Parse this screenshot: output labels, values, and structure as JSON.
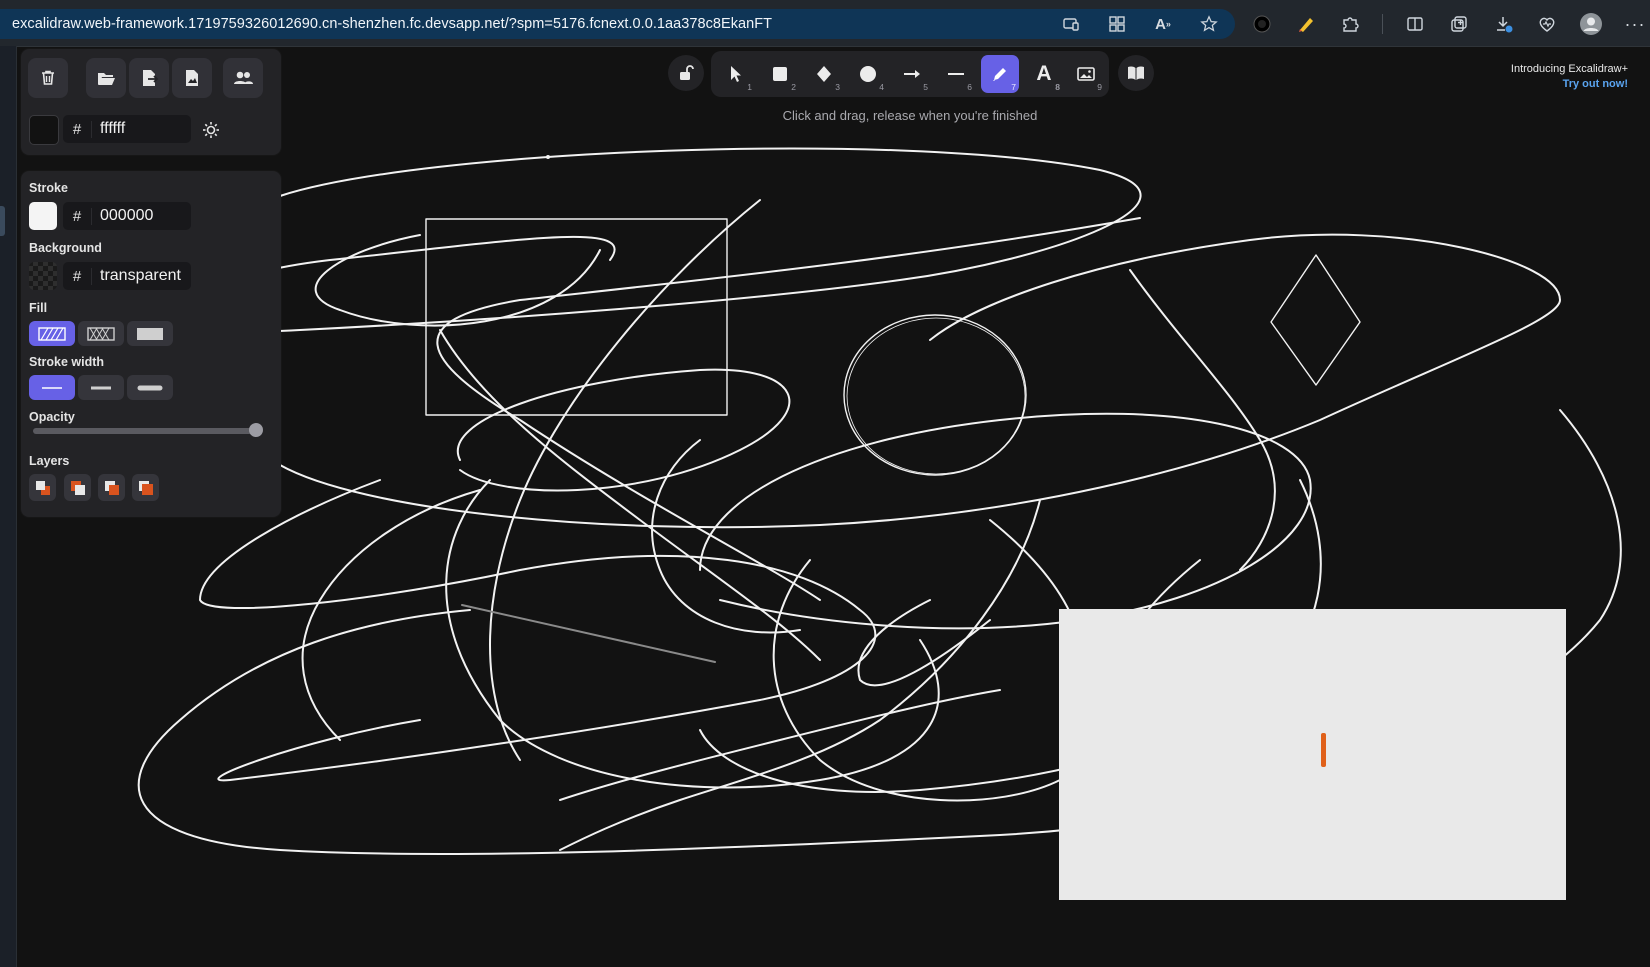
{
  "browser": {
    "url": "excalidraw.web-framework.1719759326012690.cn-shenzhen.fc.devsapp.net/?spm=5176.fcnext.0.0.1aa378c8EkanFT"
  },
  "canvas_panel": {
    "canvas_bg_hash": "#",
    "canvas_bg_value": "ffffff"
  },
  "properties": {
    "stroke_label": "Stroke",
    "stroke_hash": "#",
    "stroke_value": "000000",
    "background_label": "Background",
    "background_hash": "#",
    "background_value": "transparent",
    "fill_label": "Fill",
    "stroke_width_label": "Stroke width",
    "opacity_label": "Opacity",
    "opacity_value": 1.0,
    "layers_label": "Layers"
  },
  "toolbar": {
    "tools": [
      {
        "name": "selection",
        "key": "1"
      },
      {
        "name": "rectangle",
        "key": "2"
      },
      {
        "name": "diamond",
        "key": "3"
      },
      {
        "name": "ellipse",
        "key": "4"
      },
      {
        "name": "arrow",
        "key": "5"
      },
      {
        "name": "line",
        "key": "6"
      },
      {
        "name": "draw",
        "key": "7",
        "active": true
      },
      {
        "name": "text",
        "key": "8"
      },
      {
        "name": "image",
        "key": "9"
      }
    ],
    "hint": "Click and drag, release when you're finished"
  },
  "promo": {
    "line1": "Introducing Excalidraw+",
    "line2": "Try out now!"
  },
  "colors": {
    "accent": "#6761e6",
    "canvas": "#121212",
    "panel": "#232326",
    "link": "#5aa4f0",
    "caret": "#e0601a"
  }
}
